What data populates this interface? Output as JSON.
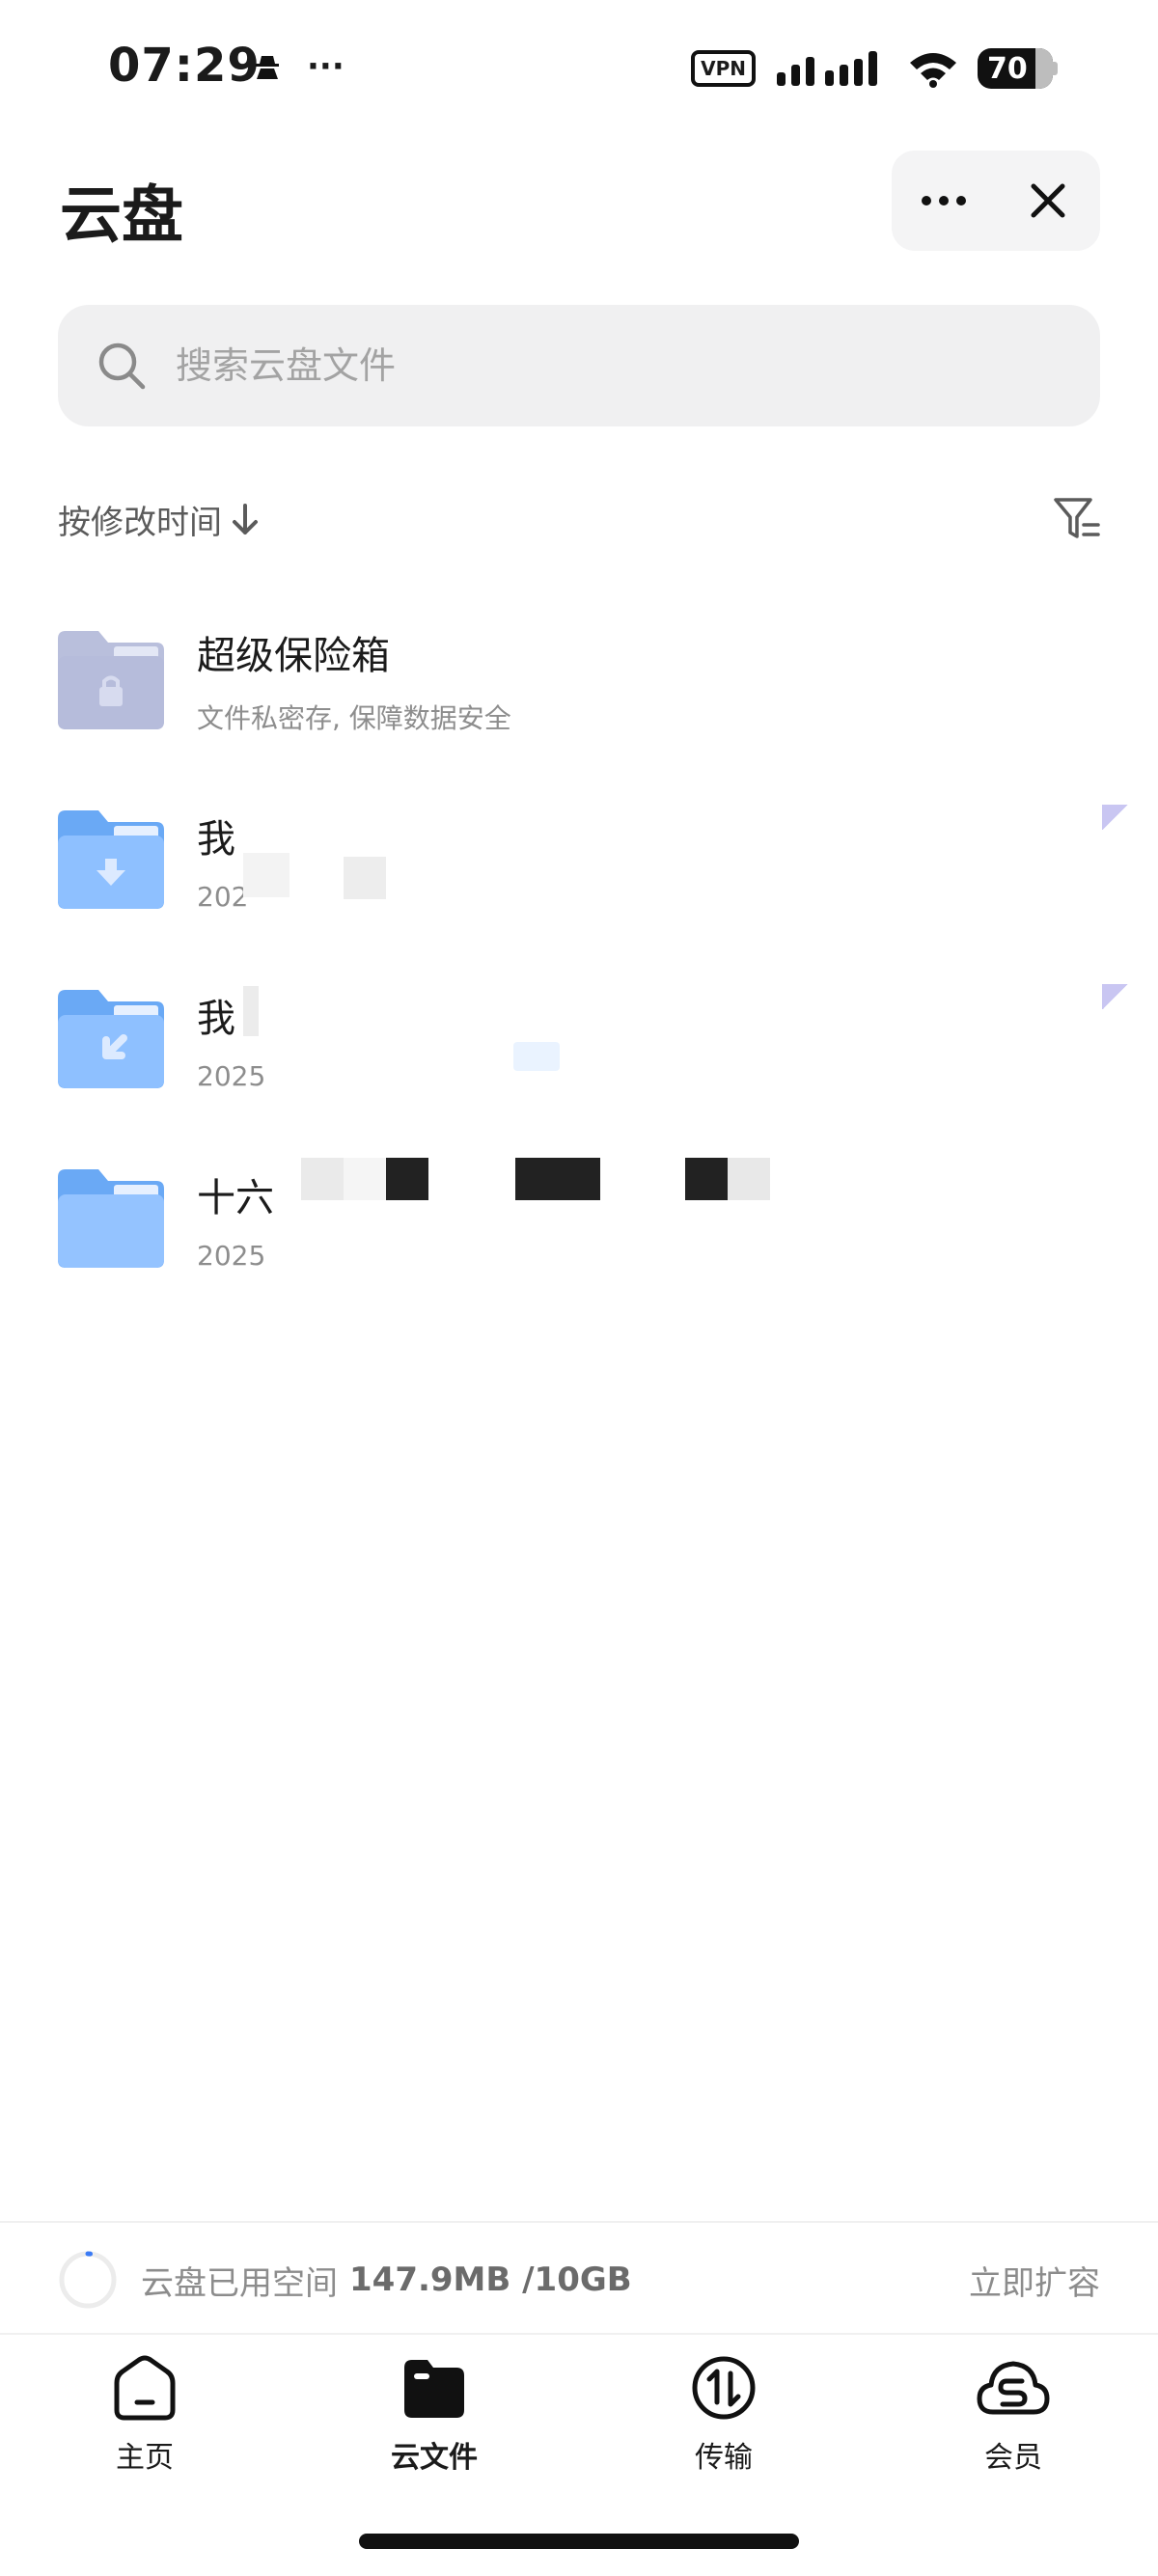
{
  "status_bar": {
    "time": "07:29",
    "vpn": "VPN",
    "battery": "70"
  },
  "header": {
    "title": "云盘",
    "more_icon": "more-horizontal-icon",
    "close_icon": "close-icon"
  },
  "search": {
    "placeholder": "搜索云盘文件"
  },
  "sort": {
    "label": "按修改时间",
    "direction_icon": "arrow-down-icon"
  },
  "files": [
    {
      "name": "超级保险箱",
      "subtitle": "文件私密存, 保障数据安全",
      "icon": "safe-folder-icon"
    },
    {
      "name": "我",
      "subtitle": "202",
      "icon": "download-folder-icon"
    },
    {
      "name": "我",
      "subtitle": "2025",
      "icon": "shared-folder-icon"
    },
    {
      "name": "十六",
      "subtitle": "2025",
      "icon": "folder-icon"
    }
  ],
  "storage": {
    "label": "云盘已用空间",
    "value": "147.9MB /10GB",
    "expand": "立即扩容",
    "used_fraction": 0.015
  },
  "nav": {
    "items": [
      {
        "label": "主页",
        "icon": "home-icon",
        "active": false
      },
      {
        "label": "云文件",
        "icon": "cloud-files-icon",
        "active": true
      },
      {
        "label": "传输",
        "icon": "transfer-icon",
        "active": false
      },
      {
        "label": "会员",
        "icon": "vip-cloud-icon",
        "active": false
      }
    ]
  },
  "colors": {
    "accent": "#3b7bf5",
    "folder_blue": "#8ec0ff",
    "safe_folder": "#b9bfdc"
  }
}
